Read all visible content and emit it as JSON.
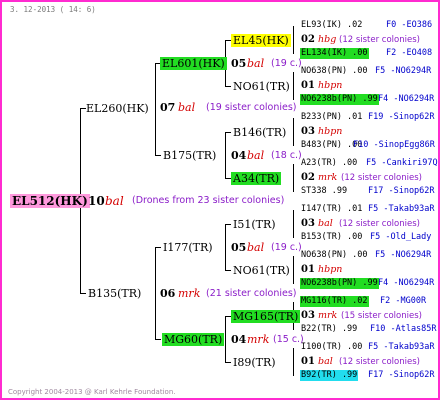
{
  "header_date": "3. 12-2013 ( 14:  6)",
  "footer": "Copyright 2004-2013 @ Karl Kehrle Foundation.",
  "root": {
    "id": "EL512(HK)",
    "num": "10",
    "mark": "bal",
    "note": "(Drones from 23 sister colonies)"
  },
  "l1": [
    {
      "id": "EL260(HK)",
      "num": "07",
      "mark": "bal",
      "note": "(19 sister colonies)"
    },
    {
      "id": "B135(TR)",
      "num": "06",
      "mark": "mrk",
      "note": "(21 sister colonies)"
    }
  ],
  "l2": [
    {
      "id": "EL601(HK)",
      "num": "05",
      "mark": "bal",
      "note": "(19 c.)"
    },
    {
      "id": "B175(TR)",
      "num": "04",
      "mark": "bal",
      "note": "(18 c.)"
    },
    {
      "id": "I177(TR)",
      "num": "05",
      "mark": "bal",
      "note": "(19 c.)"
    },
    {
      "id": "MG60(TR)",
      "num": "04",
      "mark": "mrk",
      "note": "(15 c.)"
    }
  ],
  "l3": [
    {
      "id": "EL45(HK)"
    },
    {
      "id": "NO61(TR)"
    },
    {
      "id": "B146(TR)"
    },
    {
      "id": "A34(TR)"
    },
    {
      "id": "I51(TR)"
    },
    {
      "id": "NO61(TR)"
    },
    {
      "id": "MG165(TR)"
    },
    {
      "id": "I89(TR)"
    }
  ],
  "l4": [
    {
      "a": "EL93(IK) .02",
      "a_right": "F0 -EO386",
      "num": "02",
      "mark": "hbg",
      "note": "(12 sister colonies)",
      "b": "EL134(IK) .00",
      "b_right": "F2 -EO408"
    },
    {
      "a": "NO638(PN) .00",
      "a_right": "F5 -NO6294R",
      "num": "01",
      "mark": "hbpn",
      "note": "",
      "b": "NO6238b(PN) .99",
      "b_right": "F4 -NO6294R"
    },
    {
      "a": "B233(PN) .01",
      "a_right": "F19 -Sinop62R",
      "num": "03",
      "mark": "hbpn",
      "note": "",
      "b": "B483(PN) .00",
      "b_right": "F10 -SinopEgg86R"
    },
    {
      "a": "A23(TR) .00",
      "a_right": "F5 -Cankiri97Q",
      "num": "02",
      "mark": "mrk",
      "note": "(12 sister colonies)",
      "b": "ST338 .99",
      "b_right": "F17 -Sinop62R"
    },
    {
      "a": "I147(TR) .01",
      "a_right": "F5 -Takab93aR",
      "num": "03",
      "mark": "bal",
      "note": "(12 sister colonies)",
      "b": "B153(TR) .00",
      "b_right": "F5 -Old_Lady"
    },
    {
      "a": "NO638(PN) .00",
      "a_right": "F5 -NO6294R",
      "num": "01",
      "mark": "hbpn",
      "note": "",
      "b": "NO6238b(PN) .99",
      "b_right": "F4 -NO6294R"
    },
    {
      "a": "MG116(TR) .02",
      "a_right": "F2 -MG00R",
      "num": "03",
      "mark": "mrk",
      "note": "(15 sister colonies)",
      "b": "B22(TR) .99",
      "b_right": "F10 -Atlas85R"
    },
    {
      "a": "I100(TR) .00",
      "a_right": "F5 -Takab93aR",
      "num": "01",
      "mark": "bal",
      "note": "(12 sister colonies)",
      "b": "B92(TR) .99",
      "b_right": "F17 -Sinop62R"
    }
  ]
}
